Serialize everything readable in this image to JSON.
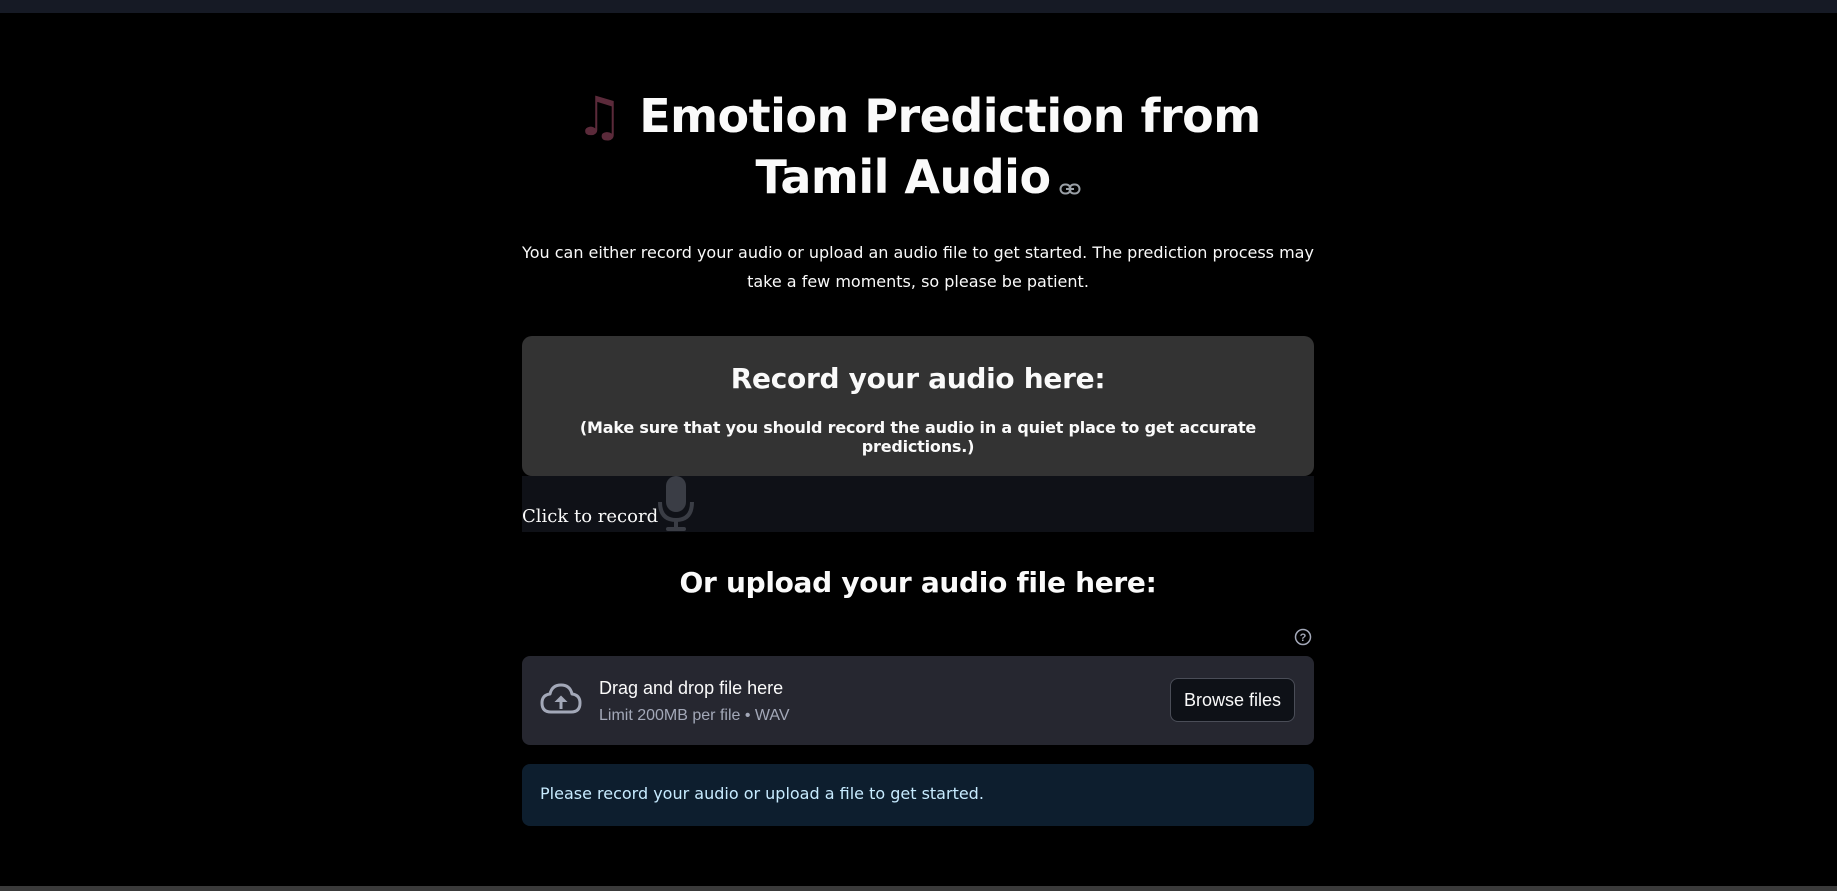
{
  "title": {
    "text": "Emotion Prediction from Tamil Audio",
    "icon": "music-note-icon"
  },
  "intro": "You can either record your audio or upload an audio file to get started. The prediction process may take a few moments, so please be patient.",
  "record": {
    "heading": "Record your audio here:",
    "note": "(Make sure that you should record the audio in a quiet place to get accurate predictions.)",
    "click_label": "Click to record"
  },
  "upload": {
    "heading": "Or upload your audio file here:",
    "drag_text": "Drag and drop file here",
    "limit_text": "Limit 200MB per file • WAV",
    "browse_label": "Browse files"
  },
  "info": "Please record your audio or upload a file to get started.",
  "colors": {
    "background": "#000000",
    "record_box": "#333333",
    "dropzone": "#262730",
    "info_box": "#0d1e2e",
    "info_text": "#c7ebff"
  }
}
